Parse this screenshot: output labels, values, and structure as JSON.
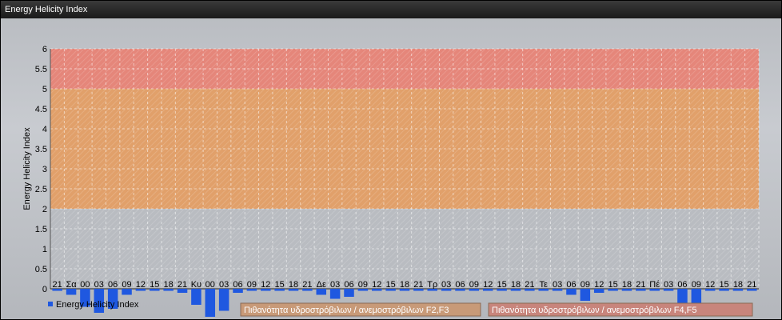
{
  "window": {
    "title": "Energy Helicity Index"
  },
  "chart_data": {
    "type": "bar",
    "title": "",
    "ylabel": "Energy Helicity Index",
    "xlabel": "",
    "ylim": [
      0,
      6
    ],
    "yticks": [
      "0",
      "0.5",
      "1",
      "1.5",
      "2",
      "2.5",
      "3",
      "3.5",
      "4",
      "4.5",
      "5",
      "5.5",
      "6"
    ],
    "xtick_labels": [
      "21",
      "Σα",
      "00",
      "03",
      "06",
      "09",
      "12",
      "15",
      "18",
      "21",
      "Κυ",
      "00",
      "03",
      "06",
      "09",
      "12",
      "15",
      "18",
      "21",
      "Δε",
      "03",
      "06",
      "09",
      "12",
      "15",
      "18",
      "21",
      "Τρ",
      "03",
      "06",
      "09",
      "12",
      "15",
      "18",
      "21",
      "Τε",
      "03",
      "06",
      "09",
      "12",
      "15",
      "18",
      "21",
      "Πέ",
      "03",
      "06",
      "09",
      "12",
      "15",
      "18",
      "21"
    ],
    "bands": [
      {
        "from": 0,
        "to": 2,
        "color": "#b9bcc1"
      },
      {
        "from": 2,
        "to": 5,
        "color": "#e1a06a"
      },
      {
        "from": 5,
        "to": 6,
        "color": "#e5867a"
      }
    ],
    "series": [
      {
        "name": "Energy Helicity Index",
        "color": "#1f58e0",
        "values": [
          -0.05,
          -0.15,
          -0.45,
          -0.6,
          -0.5,
          -0.15,
          -0.05,
          -0.05,
          -0.05,
          -0.1,
          -0.4,
          -0.7,
          -0.55,
          -0.1,
          -0.05,
          -0.05,
          -0.05,
          -0.05,
          -0.05,
          -0.15,
          -0.25,
          -0.2,
          -0.05,
          -0.05,
          -0.05,
          -0.05,
          -0.05,
          -0.05,
          -0.05,
          -0.05,
          -0.05,
          -0.05,
          -0.05,
          -0.05,
          -0.05,
          -0.05,
          -0.05,
          -0.15,
          -0.3,
          -0.1,
          -0.05,
          -0.05,
          -0.05,
          -0.05,
          -0.05,
          -0.35,
          -0.45,
          -0.05,
          -0.05,
          -0.05,
          -0.05
        ]
      }
    ],
    "legend": {
      "position": "bottom-left",
      "label": "Energy Helicity Index"
    },
    "category_boxes": [
      {
        "label": "Πιθανότητα υδροστρόβιλων / ανεμοστρόβιλων F2,F3",
        "color": "#c89a78"
      },
      {
        "label": "Πιθανότητα υδροστρόβιλων / ανεμοστρόβιλων F4,F5",
        "color": "#c8857c"
      }
    ],
    "grid": true
  }
}
